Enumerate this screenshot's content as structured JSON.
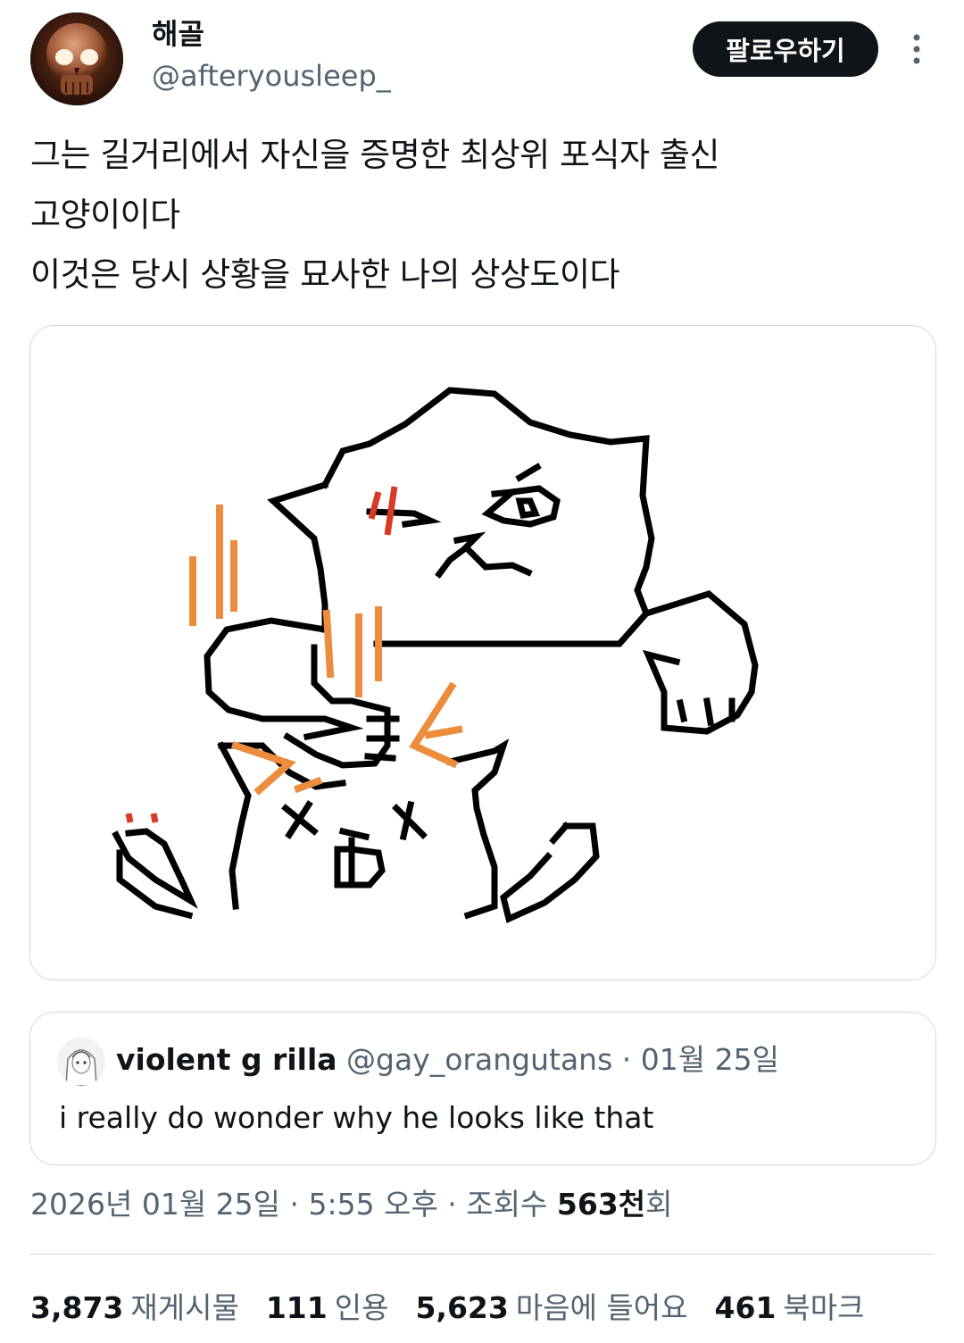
{
  "author": {
    "display_name": "해골",
    "handle": "@afteryousleep_",
    "avatar_icon": "skull-avatar"
  },
  "header": {
    "follow_label": "팔로우하기",
    "more_icon": "more-vertical-icon"
  },
  "tweet": {
    "lines": [
      "그는 길거리에서 자신을 증명한 최상위 포식자 출신",
      "고양이이다",
      "이것은 당시 상황을 묘사한 나의 상상도이다"
    ]
  },
  "media": {
    "icon": "cat-drawing",
    "colors": {
      "line": "#000000",
      "scratch": "#ec8c3c",
      "wound": "#d93a26"
    }
  },
  "quote": {
    "display_name": "violent g rilla",
    "handle": "@gay_orangutans",
    "separator": "·",
    "date": "01월 25일",
    "text": "i really do wonder why he looks like that"
  },
  "meta": {
    "datetime": "2026년 01월 25일 · 5:55 오후 · 조회수",
    "views_value": "563천",
    "views_suffix": "회"
  },
  "stats": [
    {
      "value": "3,873",
      "label": "재게시물"
    },
    {
      "value": "111",
      "label": "인용"
    },
    {
      "value": "5,623",
      "label": "마음에 들어요"
    },
    {
      "value": "461",
      "label": "북마크"
    }
  ]
}
